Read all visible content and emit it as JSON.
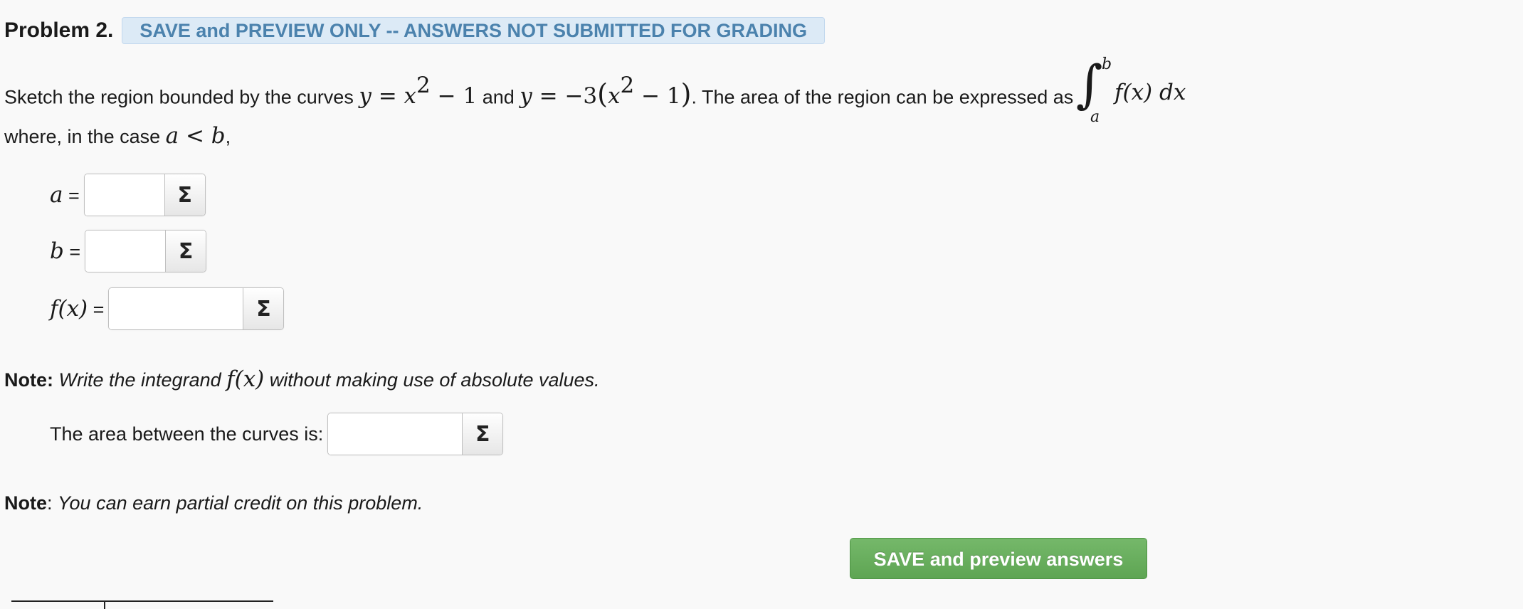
{
  "problem": {
    "title": "Problem 2.",
    "banner": "SAVE and PREVIEW ONLY -- ANSWERS NOT SUBMITTED FOR GRADING"
  },
  "statement": {
    "part1": "Sketch the region bounded by the curves ",
    "curve1": "y = x² − 1",
    "part2": " and ",
    "curve2": "y = −3(x² − 1)",
    "part3": ". The area of the region can be expressed as ",
    "integral": {
      "upper": "b",
      "lower": "a",
      "integrand": "f(x) dx"
    },
    "line2_text": "where, in the case ",
    "line2_math": "a < b",
    "line2_end": ","
  },
  "fields": [
    {
      "label": "a",
      "eq": " =",
      "value": ""
    },
    {
      "label": "b",
      "eq": " =",
      "value": ""
    },
    {
      "label": "f(x)",
      "eq": " =",
      "value": ""
    }
  ],
  "note1": {
    "bold": "Note:",
    "italic_pre": " Write the integrand ",
    "math": "f(x)",
    "italic_post": " without making use of absolute values."
  },
  "area": {
    "label": "The area between the curves is:",
    "value": ""
  },
  "note2": {
    "bold": "Note",
    "colon": ": ",
    "italic": "You can earn partial credit on this problem."
  },
  "sigma_glyph": "Σ",
  "save_button": "SAVE and preview answers",
  "colors": {
    "banner_bg": "#dceaf6",
    "banner_text": "#4b82ad",
    "button_green": "#5ea553"
  }
}
